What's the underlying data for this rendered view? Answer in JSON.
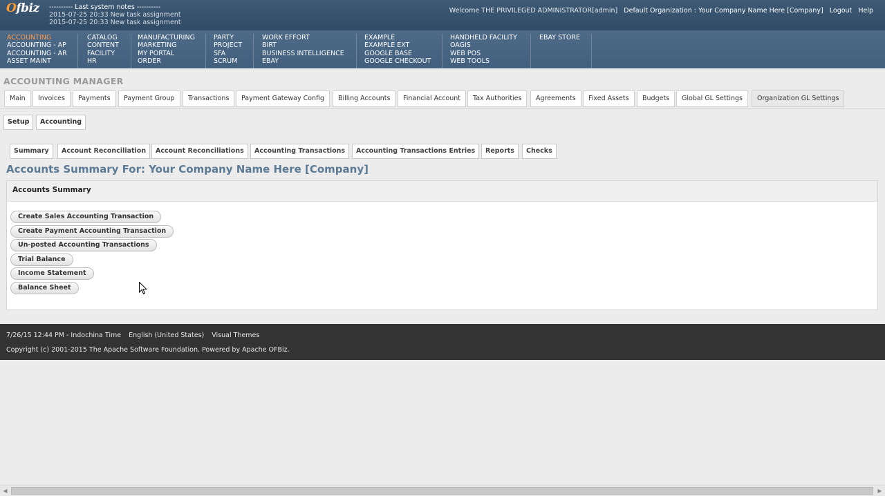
{
  "header": {
    "logo": {
      "accent": "O",
      "rest": "fbiz"
    },
    "notes_heading": "---------- Last system notes ----------",
    "notes": [
      "2015-07-25 20:33 New task assignment",
      "2015-07-25 20:33 New task assignment"
    ],
    "welcome": "Welcome THE PRIVILEGED ADMINISTRATOR[admin]",
    "organization": "Default Organization : Your Company Name Here [Company]",
    "logout": "Logout",
    "help": "Help"
  },
  "apps": {
    "col1": [
      "ACCOUNTING",
      "ACCOUNTING - AP",
      "ACCOUNTING - AR",
      "ASSET MAINT"
    ],
    "col2": [
      "CATALOG",
      "CONTENT",
      "FACILITY",
      "HR"
    ],
    "col3": [
      "MANUFACTURING",
      "MARKETING",
      "MY PORTAL",
      "ORDER"
    ],
    "col4": [
      "PARTY",
      "PROJECT",
      "SFA",
      "SCRUM"
    ],
    "col5": [
      "WORK EFFORT",
      "BIRT",
      "BUSINESS INTELLIGENCE",
      "EBAY"
    ],
    "col6": [
      "EXAMPLE",
      "EXAMPLE EXT",
      "GOOGLE BASE",
      "GOOGLE CHECKOUT"
    ],
    "col7": [
      "HANDHELD FACILITY",
      "OAGIS",
      "WEB POS",
      "WEB TOOLS"
    ],
    "col8": [
      "EBAY STORE"
    ]
  },
  "app_title": "ACCOUNTING MANAGER",
  "tabs": [
    "Main",
    "Invoices",
    "Payments",
    "Payment Group",
    "Transactions",
    "Payment Gateway Config",
    "Billing Accounts",
    "Financial Account",
    "Tax Authorities",
    "Agreements",
    "Fixed Assets",
    "Budgets",
    "Global GL Settings",
    "Organization GL Settings"
  ],
  "sub_buttons": [
    "Setup",
    "Accounting"
  ],
  "menu_tabs": [
    "Summary",
    "Account Reconciliation",
    "Account Reconciliations",
    "Accounting Transactions",
    "Accounting Transactions Entries",
    "Reports",
    "Checks"
  ],
  "page_title": "Accounts Summary For: Your Company Name Here [Company]",
  "panel": {
    "title": "Accounts Summary",
    "buttons": [
      "Create Sales Accounting Transaction",
      "Create Payment Accounting Transaction",
      "Un-posted Accounting Transactions",
      "Trial Balance",
      "Income Statement",
      "Balance Sheet"
    ]
  },
  "footer": {
    "datetime": "7/26/15 12:44 PM - Indochina Time",
    "language": "English (United States)",
    "themes": "Visual Themes",
    "copyright": "Copyright (c) 2001-2015 The Apache Software Foundation. Powered by Apache OFBiz."
  },
  "colors": {
    "header_bg": "#2f4b66",
    "appbar_bg": "#4d6a87",
    "active_app": "#ff9a50",
    "page_title": "#5b7a95",
    "footer_bg": "#333333"
  }
}
